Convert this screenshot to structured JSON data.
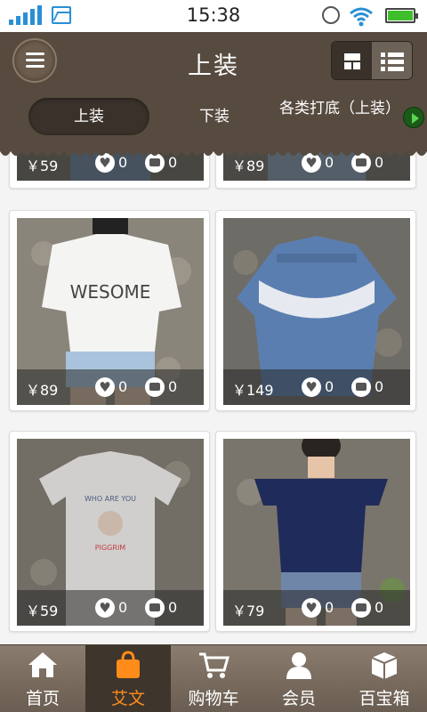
{
  "status_bar": {
    "time": "15:38"
  },
  "header": {
    "title": "上装",
    "tabs": [
      {
        "label": "上装"
      },
      {
        "label": "下装"
      },
      {
        "label": "各类打底（上装）"
      }
    ]
  },
  "products": [
    {
      "price": "￥59",
      "likes": "0",
      "comments": "0"
    },
    {
      "price": "￥89",
      "likes": "0",
      "comments": "0"
    },
    {
      "price": "￥89",
      "likes": "0",
      "comments": "0"
    },
    {
      "price": "￥149",
      "likes": "0",
      "comments": "0"
    },
    {
      "price": "￥59",
      "likes": "0",
      "comments": "0"
    },
    {
      "price": "￥79",
      "likes": "0",
      "comments": "0"
    }
  ],
  "bottom_nav": [
    {
      "label": "首页",
      "icon": "home-icon"
    },
    {
      "label": "艾文",
      "icon": "shopping-bag-icon"
    },
    {
      "label": "购物车",
      "icon": "cart-icon"
    },
    {
      "label": "会员",
      "icon": "user-icon"
    },
    {
      "label": "百宝箱",
      "icon": "box-icon"
    }
  ],
  "colors": {
    "header": "#574b40",
    "nav_active_label": "#ff8c1a",
    "signal": "#2a8fd6",
    "battery": "#3fbe2c"
  }
}
